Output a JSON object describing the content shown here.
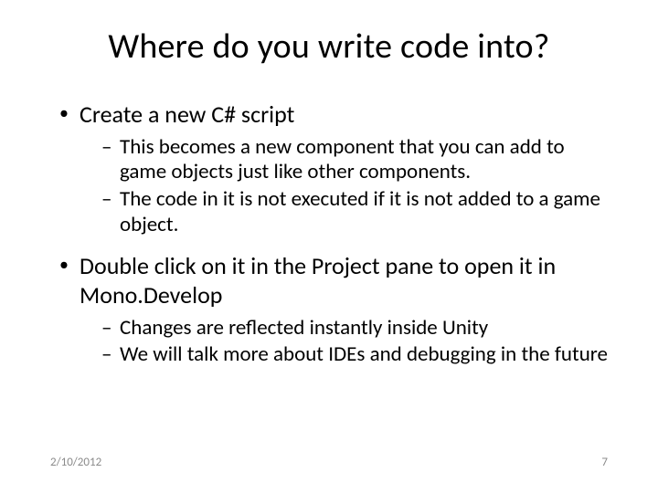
{
  "title": "Where do you write code into?",
  "items": [
    {
      "text": "Create a new C# script",
      "sub": [
        "This becomes a new component that you can add to game objects just like other components.",
        "The code in it is not executed if it is not added to a game object."
      ]
    },
    {
      "text": "Double click on it in the Project pane to open it in Mono.Develop",
      "sub": [
        "Changes are reflected instantly inside Unity",
        "We will talk more about IDEs and debugging in the future"
      ]
    }
  ],
  "footer": {
    "date": "2/10/2012",
    "page": "7"
  }
}
